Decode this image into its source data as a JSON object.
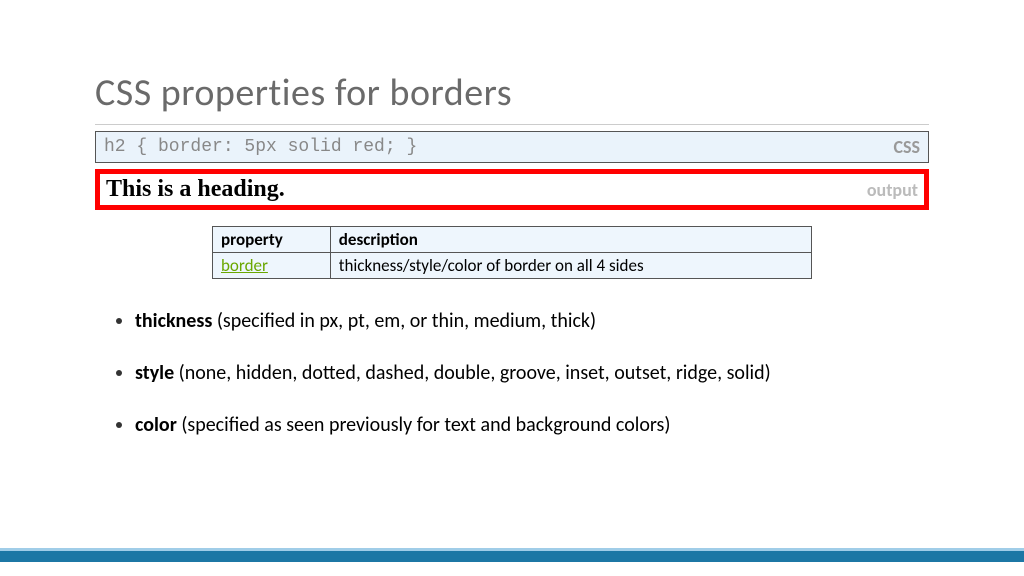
{
  "title": "CSS properties for borders",
  "code": {
    "text": "h2 { border: 5px solid red; }",
    "label": "CSS"
  },
  "output": {
    "text": "This is a heading.",
    "label": "output"
  },
  "table": {
    "headers": {
      "col1": "property",
      "col2": "description"
    },
    "row": {
      "prop": "border",
      "desc": "thickness/style/color of border on all 4 sides"
    }
  },
  "bullets": {
    "b1_bold": "thickness",
    "b1_rest": " (specified in px, pt, em, or thin, medium, thick)",
    "b2_bold": "style",
    "b2_rest": "  (none, hidden, dotted, dashed, double, groove, inset, outset, ridge, solid)",
    "b3_bold": "color",
    "b3_rest": " (specified as seen previously for text and background colors)"
  }
}
